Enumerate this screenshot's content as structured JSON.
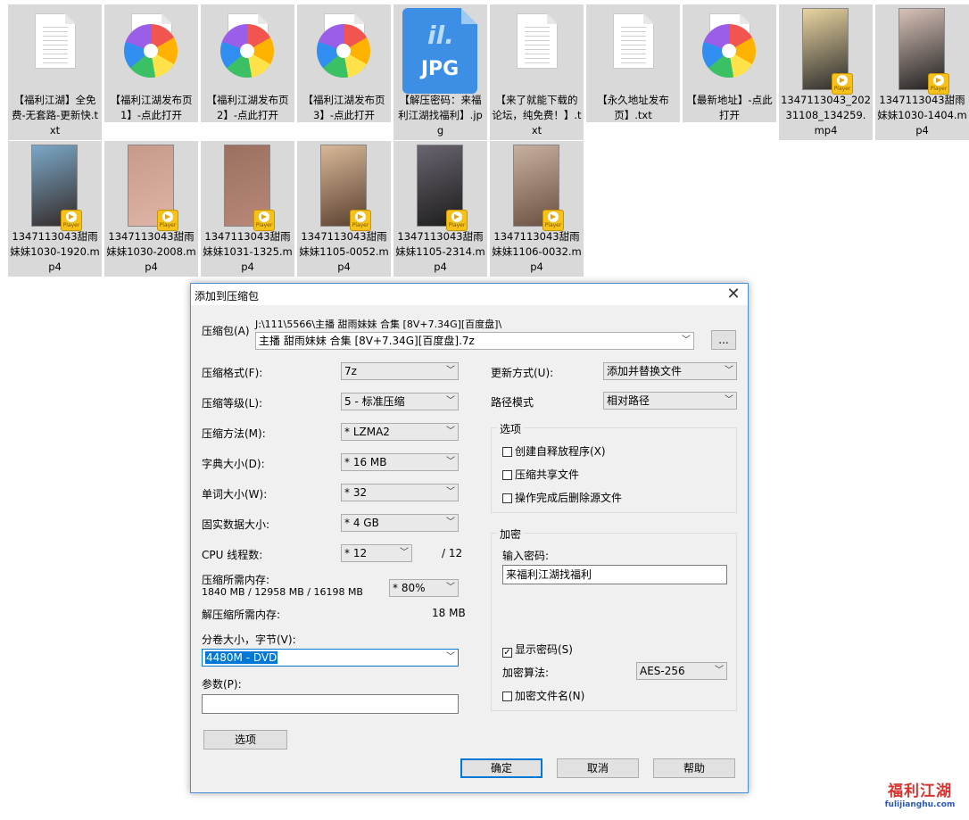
{
  "files": [
    {
      "name": "【福利江湖】全免费-无套路-更新快.txt",
      "type": "txt"
    },
    {
      "name": "【福利江湖发布页1】-点此打开",
      "type": "link"
    },
    {
      "name": "【福利江湖发布页2】-点此打开",
      "type": "link"
    },
    {
      "name": "【福利江湖发布页3】-点此打开",
      "type": "link"
    },
    {
      "name": "【解压密码：来福利江湖找福利】.jpg",
      "type": "jpg",
      "icon_text": "JPG"
    },
    {
      "name": "【来了就能下载的论坛，纯免费！】.txt",
      "type": "txt"
    },
    {
      "name": "【永久地址发布页】.txt",
      "type": "txt"
    },
    {
      "name": "【最新地址】-点此打开",
      "type": "link"
    },
    {
      "name": "1347113043_20231108_134259.mp4",
      "type": "video"
    },
    {
      "name": "1347113043甜雨妹妹1030-1404.mp4",
      "type": "video"
    },
    {
      "name": "1347113043甜雨妹妹1030-1920.mp4",
      "type": "video"
    },
    {
      "name": "1347113043甜雨妹妹1030-2008.mp4",
      "type": "video"
    },
    {
      "name": "1347113043甜雨妹妹1031-1325.mp4",
      "type": "video"
    },
    {
      "name": "1347113043甜雨妹妹1105-0052.mp4",
      "type": "video"
    },
    {
      "name": "1347113043甜雨妹妹1105-2314.mp4",
      "type": "video"
    },
    {
      "name": "1347113043甜雨妹妹1106-0032.mp4",
      "type": "video"
    }
  ],
  "player_badge": "Player",
  "dialog": {
    "title": "添加到压缩包",
    "close": "✕",
    "archive_label": "压缩包(A)",
    "archive_path": "J:\\111\\5566\\主播 甜雨妹妹 合集 [8V+7.34G][百度盘]\\",
    "archive_name": "主播 甜雨妹妹 合集 [8V+7.34G][百度盘].7z",
    "browse": "...",
    "format_label": "压缩格式(F):",
    "format_value": "7z",
    "level_label": "压缩等级(L):",
    "level_value": "5 - 标准压缩",
    "method_label": "压缩方法(M):",
    "method_value": "* LZMA2",
    "dict_label": "字典大小(D):",
    "dict_value": "* 16 MB",
    "word_label": "单词大小(W):",
    "word_value": "* 32",
    "solid_label": "固实数据大小:",
    "solid_value": "* 4 GB",
    "cpu_label": "CPU 线程数:",
    "cpu_value": "* 12",
    "cpu_total": "/ 12",
    "mem_label": "压缩所需内存:",
    "mem_values": "1840 MB / 12958 MB / 16198 MB",
    "mem_percent": "* 80%",
    "demem_label": "解压缩所需内存:",
    "demem_value": "18 MB",
    "split_label": "分卷大小，字节(V):",
    "split_value": "4480M - DVD",
    "params_label": "参数(P):",
    "params_value": "",
    "options_button": "选项",
    "update_label": "更新方式(U):",
    "update_value": "添加并替换文件",
    "path_label": "路径模式",
    "path_value": "相对路径",
    "options_group": "选项",
    "opt_sfx": "创建自释放程序(X)",
    "opt_sfx_checked": false,
    "opt_shared": "压缩共享文件",
    "opt_shared_checked": false,
    "opt_delete": "操作完成后删除源文件",
    "opt_delete_checked": false,
    "encrypt_group": "加密",
    "password_label": "输入密码:",
    "password_value": "来福利江湖找福利",
    "show_password": "显示密码(S)",
    "show_password_checked": true,
    "enc_method_label": "加密算法:",
    "enc_method_value": "AES-256",
    "encrypt_names": "加密文件名(N)",
    "encrypt_names_checked": false,
    "ok": "确定",
    "cancel": "取消",
    "help": "帮助"
  },
  "watermark": {
    "title": "福利江湖",
    "url": "fulijianghu.com"
  }
}
